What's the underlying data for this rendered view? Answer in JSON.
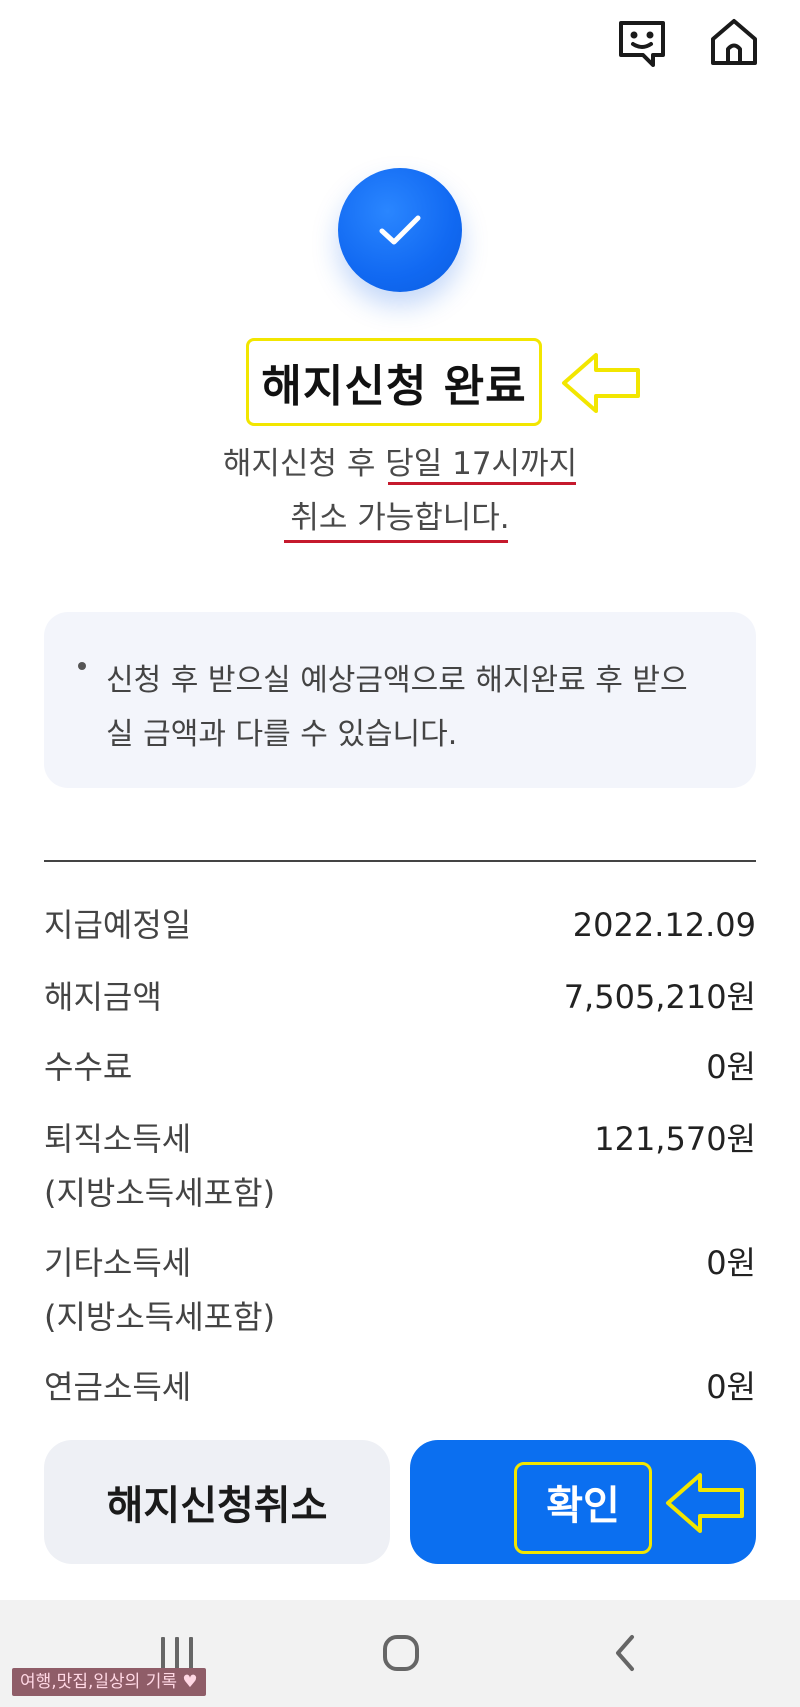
{
  "header": {
    "chat_icon": "chat-smile-icon",
    "home_icon": "home-icon"
  },
  "status": {
    "icon": "check-icon",
    "title": "해지신청 완료",
    "desc_line1": "해지신청 후 당일 17시까지",
    "desc_line2": "취소 가능합니다."
  },
  "notice": {
    "line1": "신청 후 받으실 예상금액으로 해지완료 후 받으",
    "line2": "실 금액과 다를 수 있습니다."
  },
  "details": [
    {
      "label": "지급예정일",
      "value": "2022.12.09"
    },
    {
      "label": "해지금액",
      "value": "7,505,210원"
    },
    {
      "label": "수수료",
      "value": "0원"
    },
    {
      "label": "퇴직소득세",
      "label2": "(지방소득세포함)",
      "value": "121,570원"
    },
    {
      "label": "기타소득세",
      "label2": "(지방소득세포함)",
      "value": "0원"
    },
    {
      "label": "연금소득세",
      "value": "0원"
    }
  ],
  "buttons": {
    "cancel": "해지신청취소",
    "confirm": "확인"
  },
  "navbar": {
    "recents_icon": "recents-icon",
    "home_icon": "home-circle-icon",
    "back_icon": "back-chevron-icon"
  },
  "watermark": "여행,맛집,일상의 기록 ♥",
  "colors": {
    "accent": "#0b6ff0",
    "annotation_yellow": "#f2e600",
    "annotation_red": "#c5192d"
  }
}
